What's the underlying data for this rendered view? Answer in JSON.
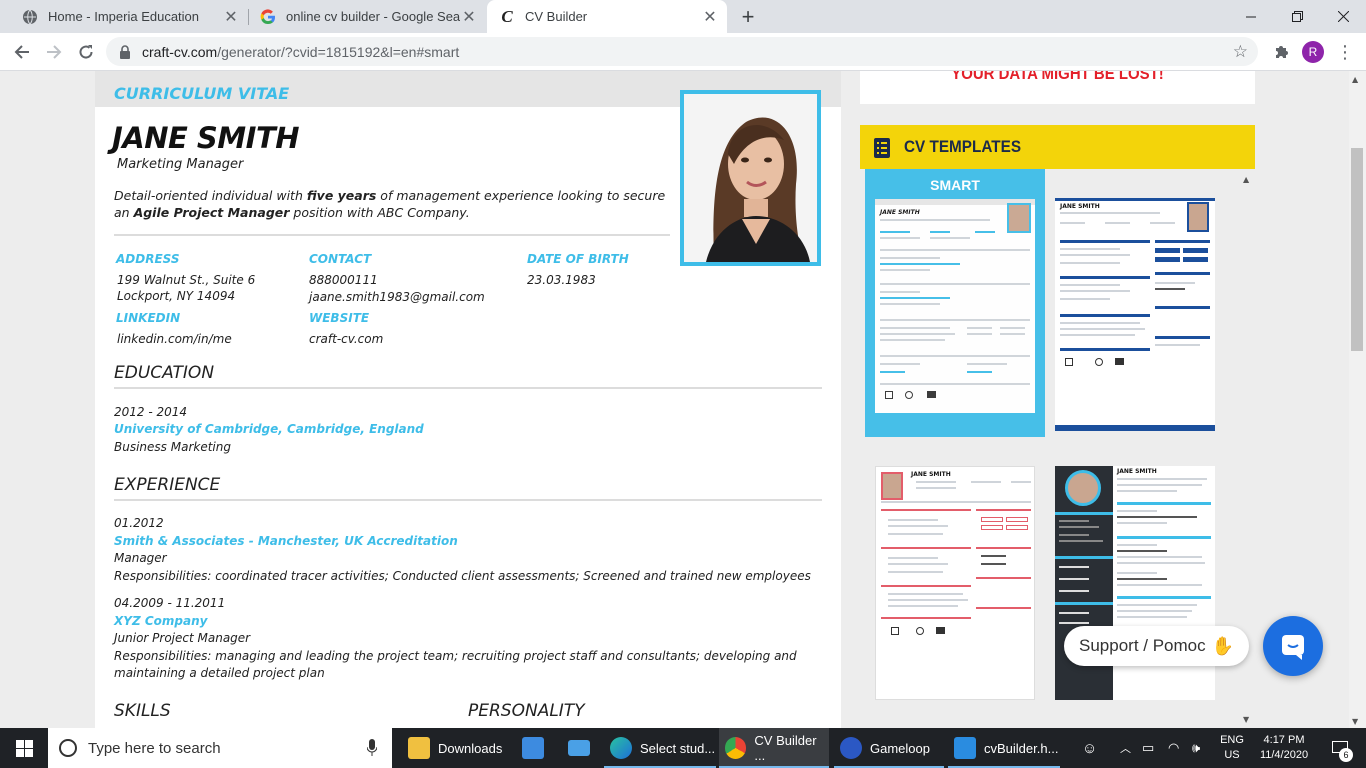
{
  "browser": {
    "tabs": [
      {
        "title": "Home - Imperia Education"
      },
      {
        "title": "online cv builder - Google Search"
      },
      {
        "title": "CV Builder"
      }
    ],
    "url_host": "craft-cv.com",
    "url_path": "/generator/?cvid=1815192&l=en#smart",
    "profile_initial": "R"
  },
  "cv": {
    "heading": "CURRICULUM VITAE",
    "name": "JANE SMITH",
    "title": "Marketing Manager",
    "summary": {
      "p1": "Detail-oriented individual with ",
      "b1": "five years",
      "p2": " of management experience looking to secure an ",
      "b2": "Agile Project Manager",
      "p3": " position with ABC Company."
    },
    "address_label": "ADDRESS",
    "address_line1": "199 Walnut St., Suite 6",
    "address_line2": "Lockport, NY 14094",
    "contact_label": "CONTACT",
    "phone": "888000111",
    "email": "jaane.smith1983@gmail.com",
    "dob_label": "DATE OF BIRTH",
    "dob": "23.03.1983",
    "linkedin_label": "LINKEDIN",
    "linkedin": "linkedin.com/in/me",
    "website_label": "WEBSITE",
    "website": "craft-cv.com",
    "education_heading": "EDUCATION",
    "education": [
      {
        "dates": "2012 - 2014",
        "school": "University of Cambridge, Cambridge, England",
        "degree": "Business Marketing"
      }
    ],
    "experience_heading": "EXPERIENCE",
    "experience": [
      {
        "dates": "01.2012",
        "company": "Smith & Associates - Manchester, UK Accreditation",
        "role": "Manager",
        "desc": "Responsibilities: coordinated tracer activities; Conducted client assessments; Screened and trained new employees"
      },
      {
        "dates": "04.2009 - 11.2011",
        "company": "XYZ Company",
        "role": "Junior Project Manager",
        "desc": "Responsibilities: managing and leading the project team; recruiting project staff and consultants; developing and maintaining a detailed project plan"
      }
    ],
    "skills_heading": "SKILLS",
    "personality_heading": "PERSONALITY"
  },
  "sidebar": {
    "warning": "YOUR DATA MIGHT BE LOST!",
    "templates_heading": "CV TEMPLATES",
    "selected_template": "SMART",
    "thumb_name": "JANE SMITH"
  },
  "chat": {
    "label": "Support / Pomoc"
  },
  "taskbar": {
    "search_placeholder": "Type here to search",
    "apps": [
      {
        "label": "Downloads"
      },
      {
        "label": "Select stud..."
      },
      {
        "label": "CV Builder ..."
      },
      {
        "label": "Gameloop"
      },
      {
        "label": "cvBuilder.h..."
      }
    ],
    "lang1": "ENG",
    "lang2": "US",
    "time": "4:17 PM",
    "date": "11/4/2020",
    "notif_count": "6"
  },
  "colors": {
    "accent": "#3ebde8",
    "template_header": "#f3d40a",
    "chat": "#1c6ee0"
  }
}
